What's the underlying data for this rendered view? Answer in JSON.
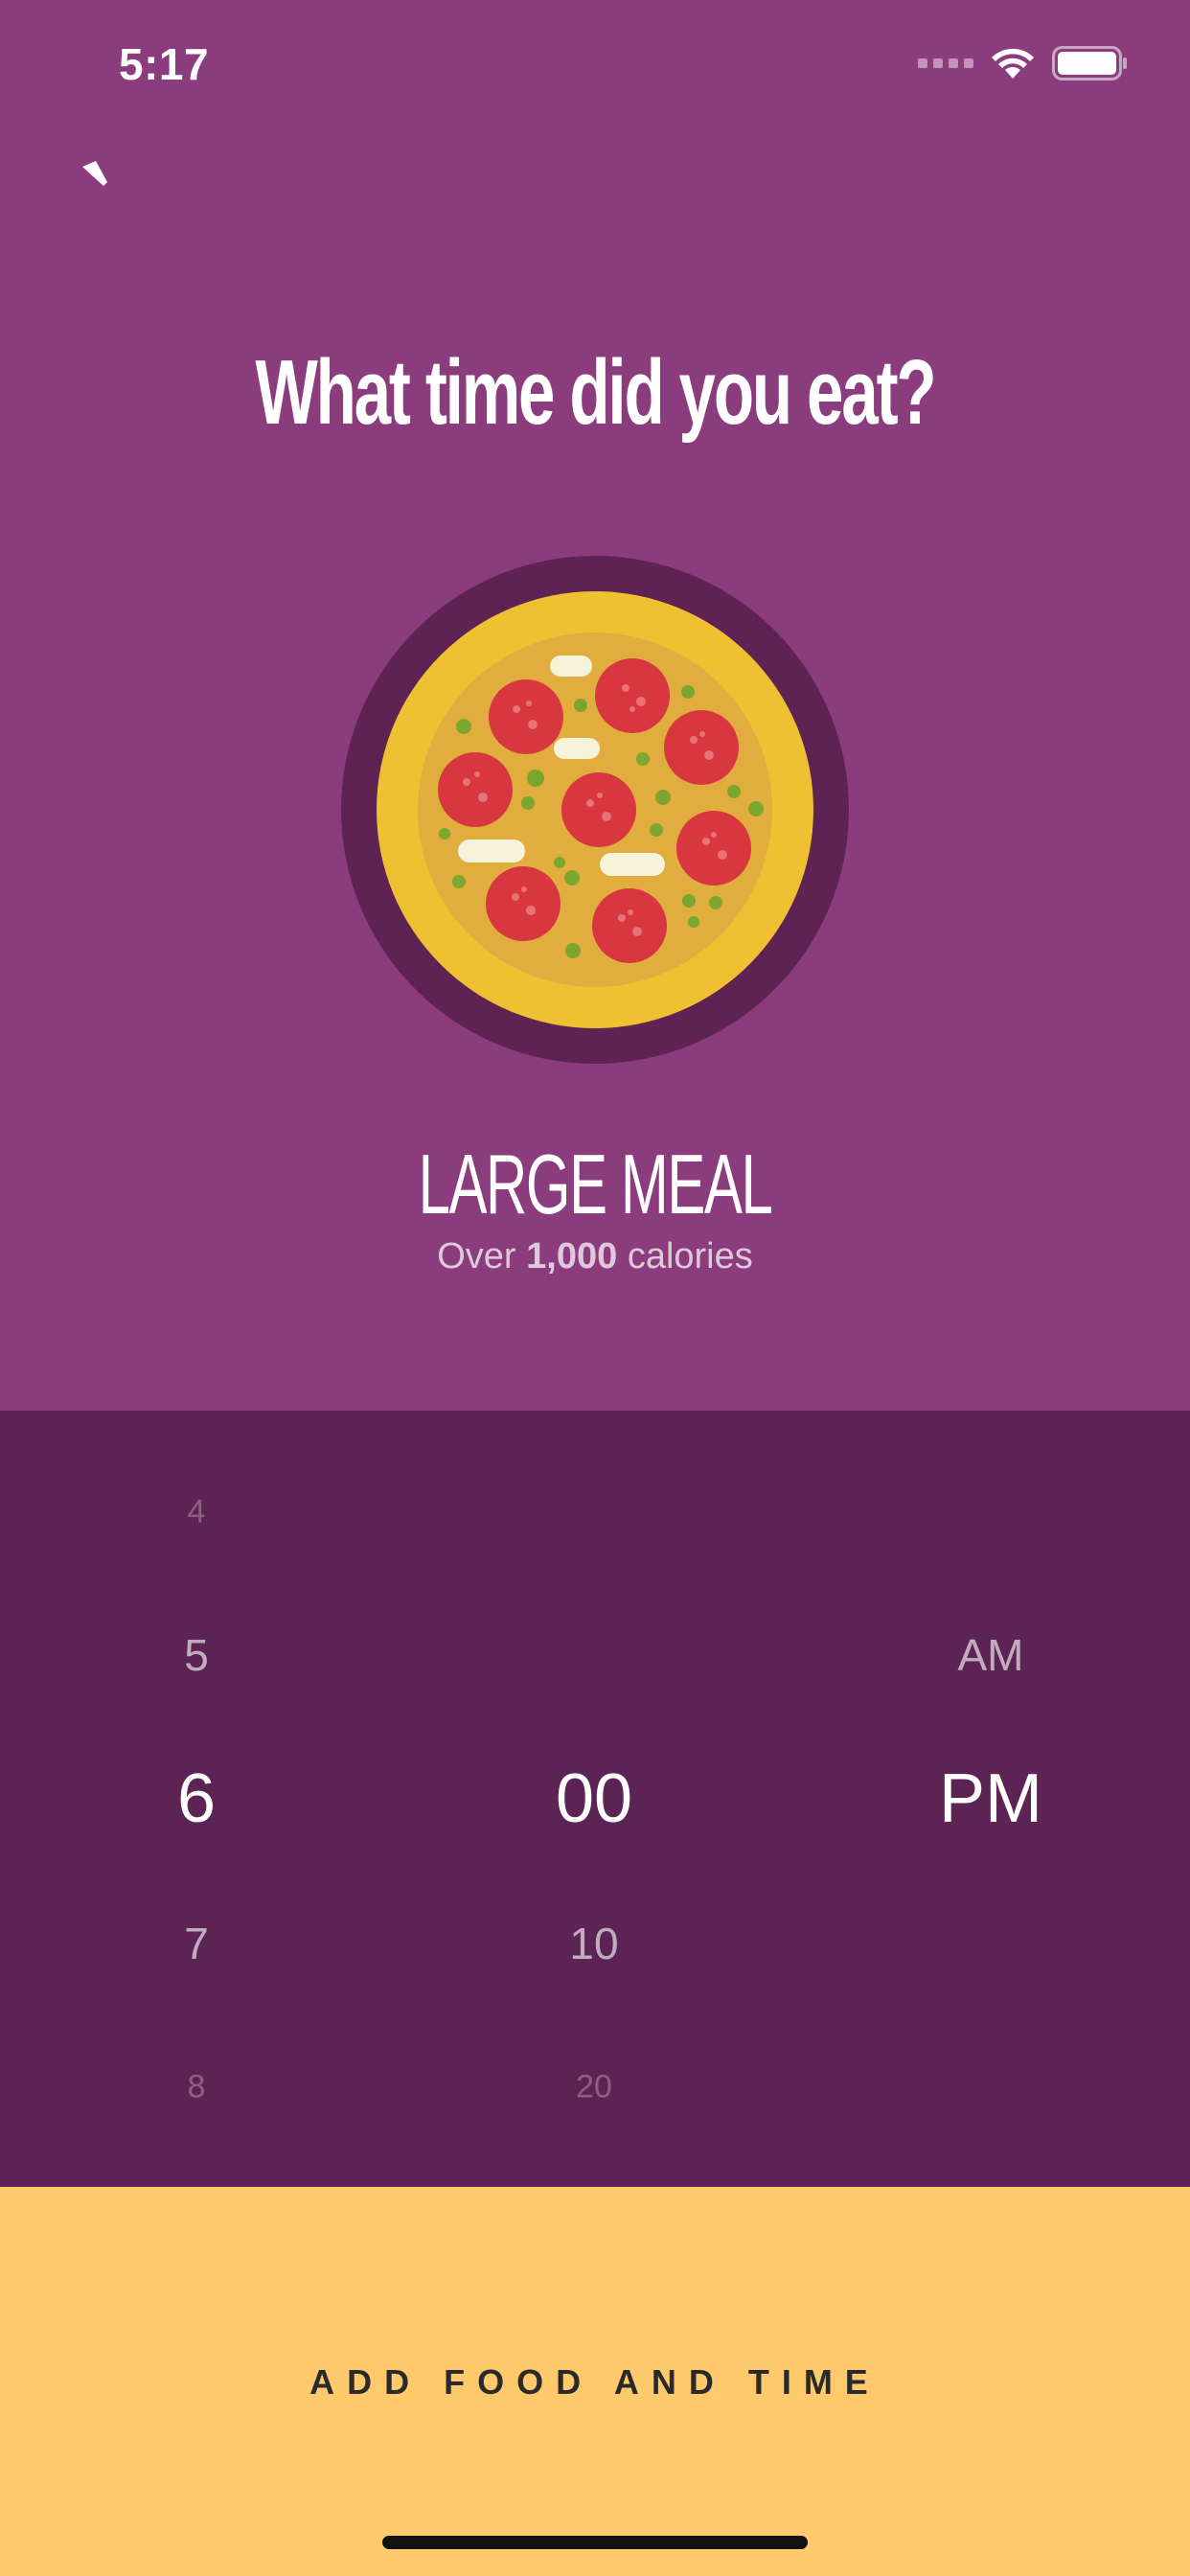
{
  "status_bar": {
    "time": "5:17",
    "icons": [
      "cellular-signal-icon",
      "wifi-icon",
      "battery-icon"
    ]
  },
  "nav": {
    "back_icon": "back-chevron-icon"
  },
  "title": "What time did you eat?",
  "meal": {
    "illustration": "pizza-illustration",
    "size_label": "LARGE MEAL",
    "calories_prefix": "Over",
    "calories_value": "1,000",
    "calories_suffix": "calories"
  },
  "picker": {
    "hour": {
      "items": [
        "4",
        "5",
        "6",
        "7",
        "8"
      ],
      "selected": "6"
    },
    "minute": {
      "items": [
        "00",
        "10",
        "20"
      ],
      "selected": "00"
    },
    "period": {
      "items": [
        "AM",
        "PM"
      ],
      "selected": "PM"
    }
  },
  "cta": {
    "label": "ADD FOOD AND TIME"
  },
  "colors": {
    "background": "#8B3C7D",
    "picker_background": "#5C2454",
    "cta_background": "#FFC96C",
    "cta_text": "#2A2A2A",
    "pizza_crust": "#F0C033",
    "pepperoni": "#D9373F"
  }
}
